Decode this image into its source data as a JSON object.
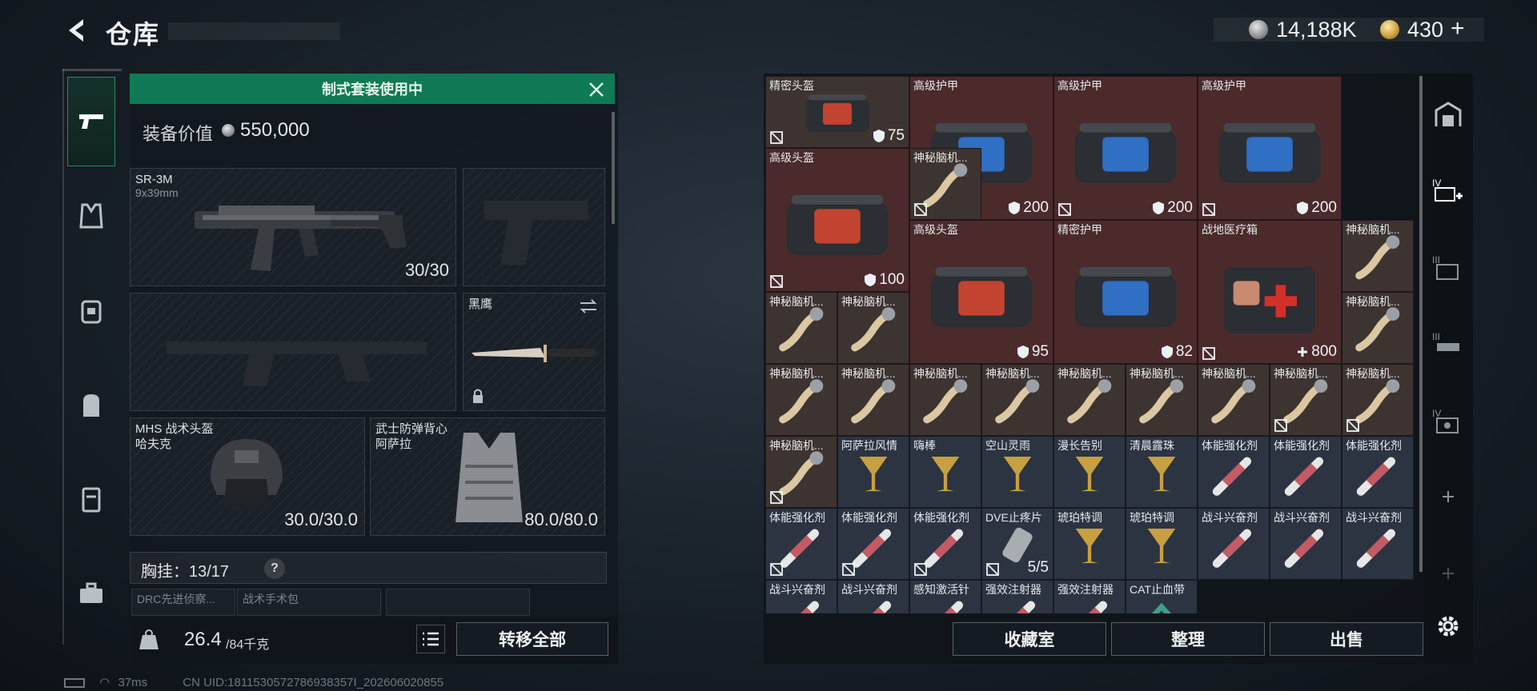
{
  "header": {
    "title": "仓库",
    "money": "14,188K",
    "gold": "430",
    "gold_add": "+"
  },
  "loadout": {
    "banner": "制式套装使用中",
    "value_label": "装备价值",
    "value": "550,000",
    "primary": {
      "name": "SR-3M",
      "caliber": "9x39mm",
      "ammo": "30/30"
    },
    "melee": {
      "name": "黑鹰"
    },
    "helmet": {
      "name": "MHS 战术头盔",
      "sub": "哈夫克",
      "durability": "30.0/30.0"
    },
    "armor": {
      "name": "武士防弹背心",
      "sub": "阿萨拉",
      "durability": "80.0/80.0"
    },
    "chest_label": "胸挂：",
    "chest_count": "13/17",
    "chest_help": "?",
    "mini_slots": [
      "DRC先进侦察...",
      "战术手术包",
      ""
    ],
    "weight": "26.4",
    "weight_max": "/84千克",
    "transfer_label": "转移全部"
  },
  "storage": {
    "cells": [
      {
        "name": "精密头盔",
        "value": "75",
        "kind": "shield",
        "tag": true
      },
      {
        "name": "高级护甲",
        "value": "200",
        "kind": "shield",
        "tag": true
      },
      {
        "name": "高级护甲",
        "value": "200",
        "kind": "shield",
        "tag": true
      },
      {
        "name": "高级护甲",
        "value": "200",
        "kind": "shield",
        "tag": true
      },
      {
        "name": "高级头盔",
        "value": "100",
        "kind": "shield",
        "tag": true
      },
      {
        "name": "神秘脑机...",
        "value": "",
        "kind": "",
        "tag": true
      },
      {
        "name": "高级头盔",
        "value": "95",
        "kind": "shield",
        "tag": false
      },
      {
        "name": "精密护甲",
        "value": "82",
        "kind": "shield",
        "tag": false
      },
      {
        "name": "战地医疗箱",
        "value": "800",
        "kind": "plus",
        "tag": true
      },
      {
        "name": "神秘脑机...",
        "value": "",
        "kind": "",
        "tag": false
      },
      {
        "name": "神秘脑机...",
        "value": "",
        "kind": "",
        "tag": false
      },
      {
        "name": "神秘脑机...",
        "value": "",
        "kind": "",
        "tag": false
      },
      {
        "name": "神秘脑机...",
        "value": "",
        "kind": "",
        "tag": false
      },
      {
        "name": "神秘脑机...",
        "value": "",
        "kind": "",
        "tag": false
      },
      {
        "name": "神秘脑机...",
        "value": "",
        "kind": "",
        "tag": false
      },
      {
        "name": "神秘脑机...",
        "value": "",
        "kind": "",
        "tag": false
      },
      {
        "name": "神秘脑机...",
        "value": "",
        "kind": "",
        "tag": false
      },
      {
        "name": "神秘脑机...",
        "value": "",
        "kind": "",
        "tag": false
      },
      {
        "name": "神秘脑机...",
        "value": "",
        "kind": "",
        "tag": false
      },
      {
        "name": "神秘脑机...",
        "value": "",
        "kind": "",
        "tag": false
      },
      {
        "name": "神秘脑机...",
        "value": "",
        "kind": "",
        "tag": true
      },
      {
        "name": "神秘脑机...",
        "value": "",
        "kind": "",
        "tag": true
      },
      {
        "name": "神秘脑机...",
        "value": "",
        "kind": "",
        "tag": true
      },
      {
        "name": "阿萨拉风情",
        "value": "",
        "kind": "",
        "tag": false
      },
      {
        "name": "嗨棒",
        "value": "",
        "kind": "",
        "tag": false
      },
      {
        "name": "空山灵雨",
        "value": "",
        "kind": "",
        "tag": false
      },
      {
        "name": "漫长告别",
        "value": "",
        "kind": "",
        "tag": false
      },
      {
        "name": "清晨露珠",
        "value": "",
        "kind": "",
        "tag": false
      },
      {
        "name": "体能强化剂",
        "value": "",
        "kind": "",
        "tag": false
      },
      {
        "name": "体能强化剂",
        "value": "",
        "kind": "",
        "tag": false
      },
      {
        "name": "体能强化剂",
        "value": "",
        "kind": "",
        "tag": false
      },
      {
        "name": "体能强化剂",
        "value": "",
        "kind": "",
        "tag": true
      },
      {
        "name": "体能强化剂",
        "value": "",
        "kind": "",
        "tag": true
      },
      {
        "name": "体能强化剂",
        "value": "",
        "kind": "",
        "tag": true
      },
      {
        "name": "DVE止疼片",
        "value": "5/5",
        "kind": "",
        "tag": true
      },
      {
        "name": "琥珀特调",
        "value": "",
        "kind": "",
        "tag": false
      },
      {
        "name": "琥珀特调",
        "value": "",
        "kind": "",
        "tag": false
      },
      {
        "name": "战斗兴奋剂",
        "value": "",
        "kind": "",
        "tag": false
      },
      {
        "name": "战斗兴奋剂",
        "value": "",
        "kind": "",
        "tag": false
      },
      {
        "name": "战斗兴奋剂",
        "value": "",
        "kind": "",
        "tag": false
      },
      {
        "name": "战斗兴奋剂",
        "value": "",
        "kind": "",
        "tag": false
      },
      {
        "name": "战斗兴奋剂",
        "value": "",
        "kind": "",
        "tag": false
      },
      {
        "name": "感知激活针",
        "value": "",
        "kind": "",
        "tag": false
      },
      {
        "name": "强效注射器",
        "value": "",
        "kind": "",
        "tag": false
      },
      {
        "name": "强效注射器",
        "value": "",
        "kind": "",
        "tag": false
      },
      {
        "name": "CAT止血带",
        "value": "",
        "kind": "",
        "tag": false
      }
    ],
    "buttons": [
      "收藏室",
      "整理",
      "出售"
    ]
  },
  "status": {
    "ping": "37ms",
    "uid": "CN UID:1811530572786938357I_202606020855"
  },
  "colors": {
    "banner": "#0f7a55",
    "accent": "#1f8a6f"
  }
}
